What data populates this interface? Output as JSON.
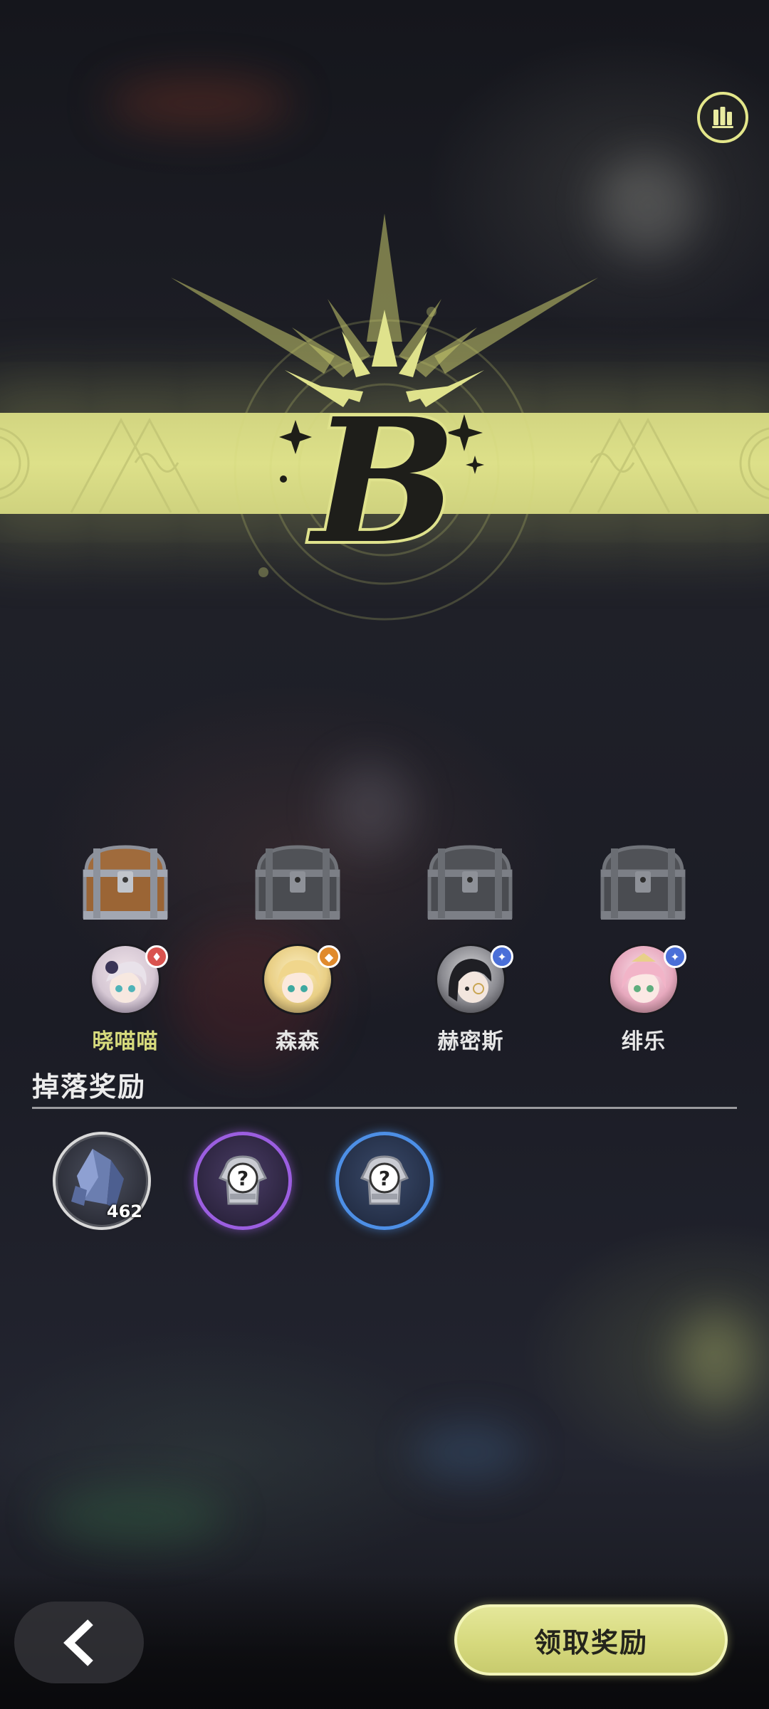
{
  "grade": {
    "letter": "B",
    "accent_color": "#d8db84"
  },
  "header": {
    "stats_icon": "bar-chart-icon"
  },
  "chests": [
    {
      "state": "opened",
      "icon": "treasure-chest-gold-icon"
    },
    {
      "state": "locked",
      "icon": "treasure-chest-grey-icon"
    },
    {
      "state": "locked",
      "icon": "treasure-chest-grey-icon"
    },
    {
      "state": "locked",
      "icon": "treasure-chest-grey-icon"
    }
  ],
  "characters": [
    {
      "name": "晓喵喵",
      "active": true,
      "badge_color": "#d9534f",
      "badge_icon": "element-fire-icon"
    },
    {
      "name": "森森",
      "active": false,
      "badge_color": "#e08a2c",
      "badge_icon": "element-rock-icon"
    },
    {
      "name": "赫密斯",
      "active": false,
      "badge_color": "#4a6fd8",
      "badge_icon": "element-water-icon"
    },
    {
      "name": "绯乐",
      "active": false,
      "badge_color": "#4a6fd8",
      "badge_icon": "element-water-icon"
    }
  ],
  "rewards": {
    "title": "掉落奖励",
    "items": [
      {
        "icon": "crystal-ore-icon",
        "count": "462",
        "rarity_color": "#d8d8d8"
      },
      {
        "icon": "mystery-armor-icon",
        "count": "",
        "rarity_color": "#9b5ee0"
      },
      {
        "icon": "mystery-armor-icon",
        "count": "",
        "rarity_color": "#4d8fe6"
      }
    ]
  },
  "footer": {
    "back_icon": "chevron-left-icon",
    "claim_label": "领取奖励"
  }
}
